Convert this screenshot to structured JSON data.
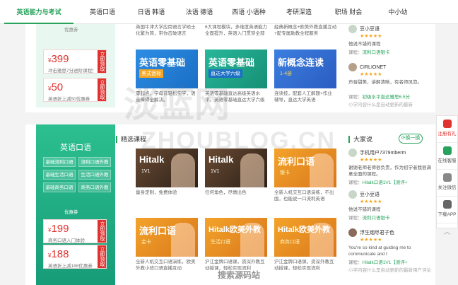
{
  "nav": [
    "英语能力与考试",
    "英语口语",
    "日语 韩语",
    "法语 德语",
    "西语 小语种",
    "考研深造",
    "职场 财会",
    "中小幼"
  ],
  "sec1": {
    "coupons": [
      {
        "price": "399",
        "desc": "冲击雅思7分进阶课程免费",
        "btn": "立即领取"
      },
      {
        "price": "50",
        "desc": "英语折上减50优惠券",
        "btn": "立即领取"
      }
    ],
    "coupon_label": "优惠券",
    "top_descs": [
      "英国牛津大学应用语言学硕士化繁为简，带你击破语言",
      "6大课程模块，多维度英语能力全面提升，英语入门贯穿全部",
      "经典新概念+欧美外教直播互动+配专属助教全程服务"
    ],
    "cards": [
      {
        "title": "英语零基础",
        "sub": "美式音标",
        "desc": "零起点，学母音轻松实学，语音障碍全解决。"
      },
      {
        "title": "英语零基础",
        "sub": "直达大学六级",
        "desc": "英语零基础直达高级英语水平，英语零基础直达大学六级"
      },
      {
        "title": "新概念连读",
        "sub": "1-4册",
        "desc": "连读技，配套人工解题+作业辅导，直达大学英语"
      }
    ],
    "reviews": [
      {
        "user": "豆小豆语",
        "stars": "★★★★★",
        "text": "他说不错的课程",
        "course_label": "课程：",
        "course": "流利口语银卡"
      },
      {
        "user": "CIRLIONET",
        "stars": "★★★★★",
        "text": "声音甜美，讲解清晰，有名师风范。",
        "course_label": "课程：",
        "course": "初级水平直达雅思6.5分"
      }
    ],
    "review_footer": "小学内容什么是自动更新的最新"
  },
  "sec2": {
    "heading": "精选课程",
    "panel_title": "英语口语",
    "tags": [
      "基础流利口语",
      "流利口语外教",
      "基础生活口语",
      "生活口语外教",
      "基础商务口语",
      "商务口语外教"
    ],
    "coupon_label": "优惠券",
    "coupons": [
      {
        "price": "199",
        "desc": "商务口语入门体验",
        "btn": "立即领取"
      },
      {
        "price": "188",
        "desc": "英语折上减188优惠券",
        "btn": "立即领取"
      }
    ],
    "cards": [
      {
        "title": "Hitalk",
        "sub": "1V1",
        "desc": "量身定制，免费体验"
      },
      {
        "title": "Hitalk",
        "sub": "1V1",
        "desc": "任何角色，尽情出色"
      },
      {
        "title": "流利口语",
        "sub": "银卡",
        "desc": "全新人机交互口语演练，不出国，也能说一口流利英语"
      },
      {
        "title": "流利口语",
        "sub": "金卡",
        "desc": "全新人机交互口语演练，欧美外教小班口语直播互动"
      },
      {
        "title": "Hitalk欧美外教",
        "sub": "生活口语",
        "desc": "沪江金牌口语课，资深外教互动授课，轻松实现流利"
      },
      {
        "title": "Hitalk欧美外教",
        "sub": "商务口语",
        "desc": "沪江金牌口语课，资深外教互动授课，轻松实现流利"
      }
    ],
    "dajia": "大家说",
    "swap": "换一换",
    "reviews": [
      {
        "user": "手机用户7379mberm",
        "stars": "★★★★★",
        "text": "谢谢老师老师很负责，作为初学者我很满意全面的课程。",
        "course_label": "课程：",
        "course": "Hitalk口语1V1【测评+"
      },
      {
        "user": "豆小豆语",
        "stars": "★★★★★",
        "text": "他说不错的课程",
        "course_label": "课程：",
        "course": "流利口语银卡"
      },
      {
        "user": "浮生烟尽君子色",
        "stars": "★★★★★",
        "text": "You're so kind at guiding me to communicate and t",
        "course_label": "课程：",
        "course": "Hitalk口语1V1【测评+"
      }
    ],
    "review_footer": "小学内容什么是自动更新的最新用户评论"
  },
  "sidebar": [
    "注册有礼",
    "在线客服",
    "关注微信",
    "下载APP",
    "︿"
  ],
  "watermark": {
    "cn": "淡蓝网",
    "en": "ZHOUBLOG.CN",
    "logo": "搜索源码站"
  }
}
